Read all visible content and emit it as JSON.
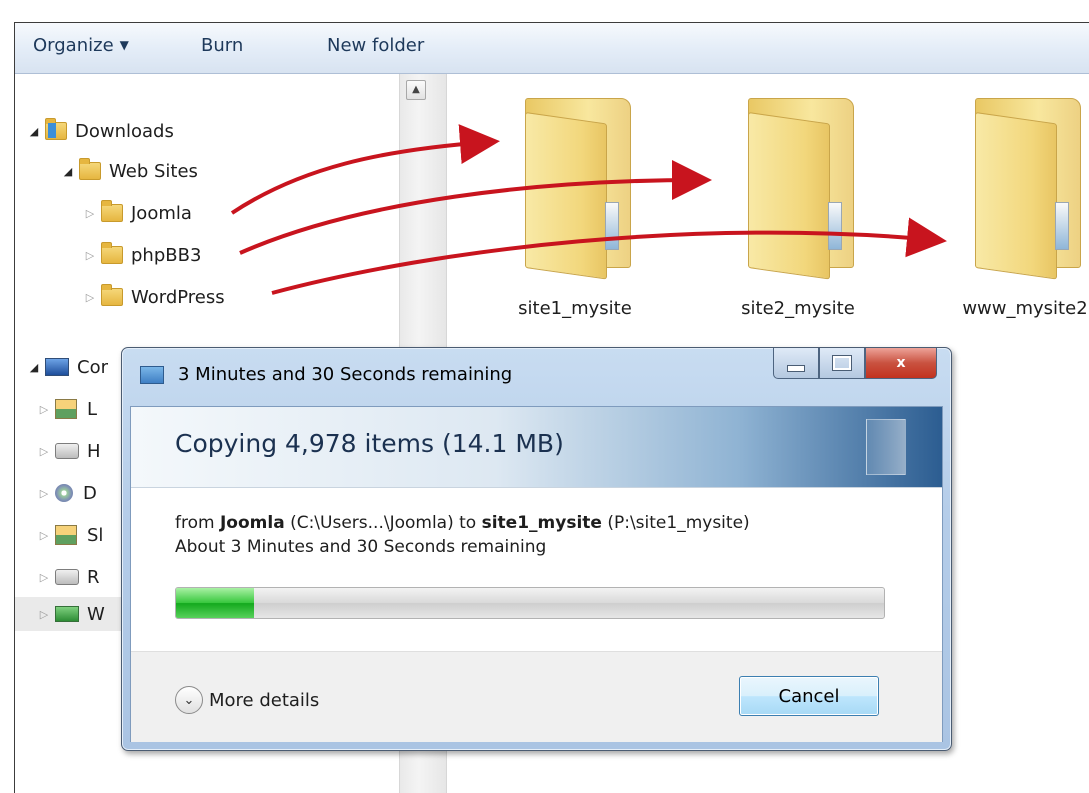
{
  "toolbar": {
    "organize": "Organize",
    "burn": "Burn",
    "new_folder": "New folder"
  },
  "nav": {
    "downloads": "Downloads",
    "web_sites": "Web Sites",
    "joomla": "Joomla",
    "phpbb3": "phpBB3",
    "wordpress": "WordPress",
    "computer_partial": "Cor",
    "drive_items": [
      "L",
      "H",
      "D",
      "Sl",
      "R",
      "W"
    ]
  },
  "folders": [
    "site1_mysite",
    "site2_mysite",
    "www_mysite2"
  ],
  "dialog": {
    "title": "3 Minutes and 30 Seconds remaining",
    "heading": "Copying 4,978 items (14.1 MB)",
    "from_prefix": "from ",
    "from_name": "Joomla",
    "from_path": " (C:\\Users...\\Joomla) to ",
    "to_name": "site1_mysite",
    "to_path": " (P:\\site1_mysite)",
    "time_remaining": "About 3 Minutes and 30 Seconds remaining",
    "progress_fraction": 0.11,
    "more_details": "More details",
    "cancel": "Cancel",
    "close_glyph": "x"
  },
  "colors": {
    "arrow": "#c8141e",
    "progress": "#2fc236"
  }
}
